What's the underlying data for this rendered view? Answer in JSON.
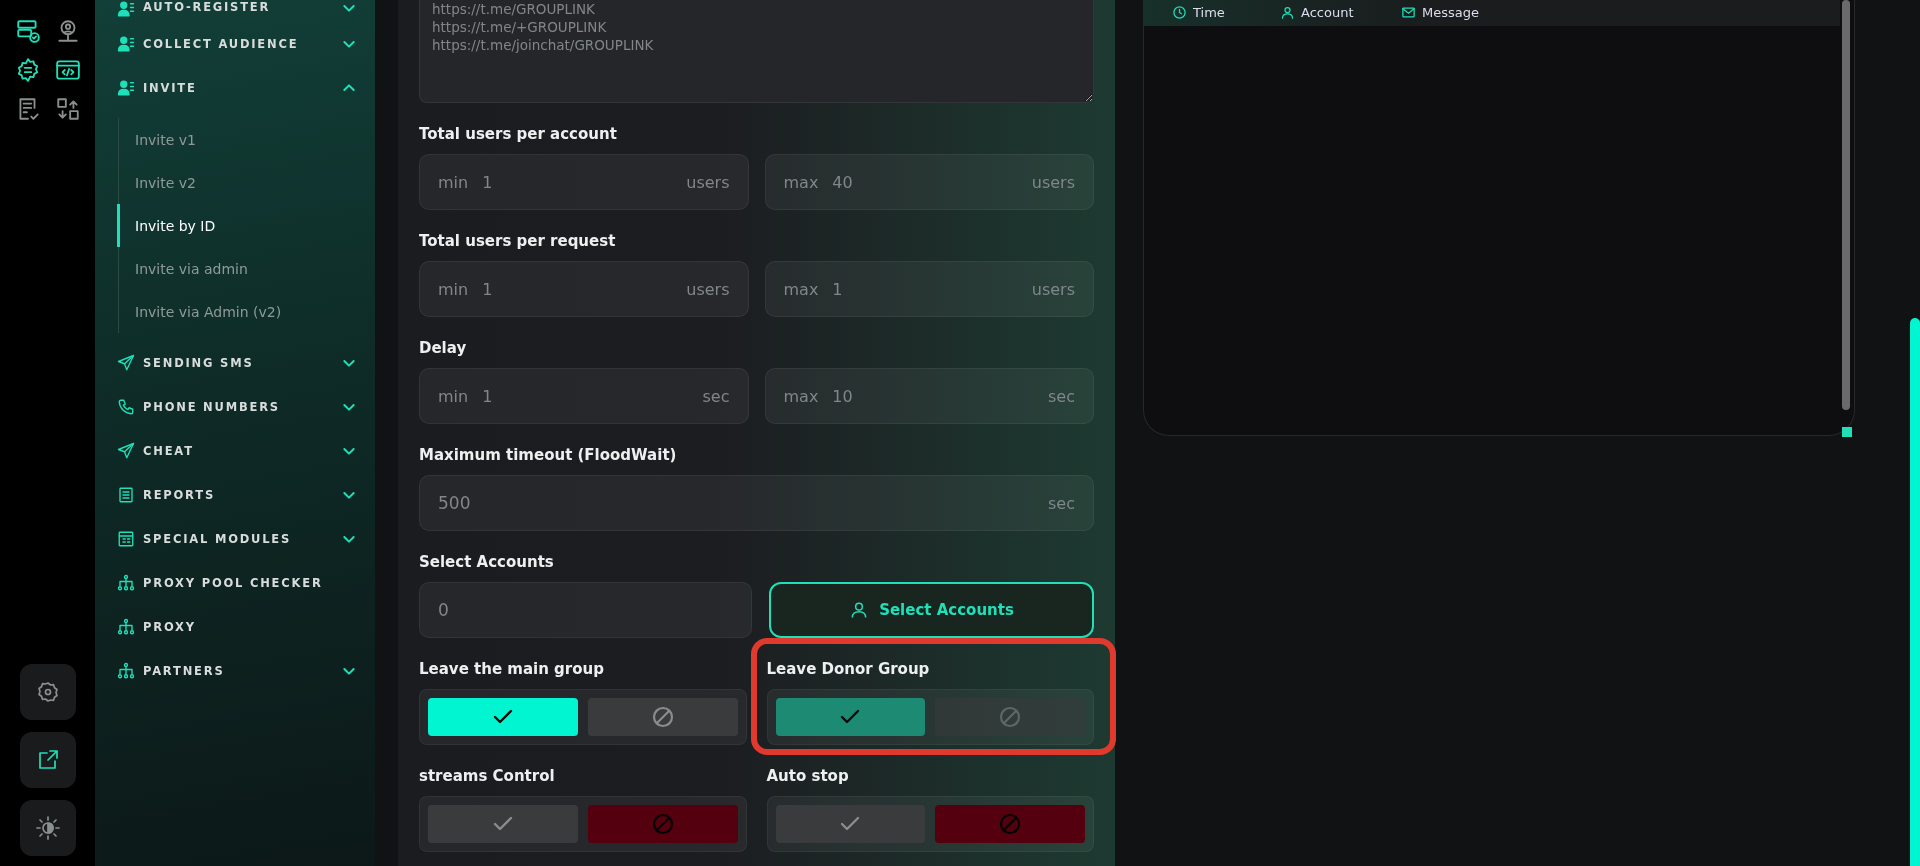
{
  "rail": {
    "icons": [
      {
        "active": true
      },
      {
        "active": false
      },
      {
        "active": true
      },
      {
        "active": true
      },
      {
        "active": false
      },
      {
        "active": false
      }
    ],
    "buttons": [
      {
        "active": false
      },
      {
        "active": true
      },
      {
        "active": false
      }
    ]
  },
  "sidebar": {
    "items": [
      {
        "label": "AUTO-REGISTER",
        "expanded": false
      },
      {
        "label": "COLLECT AUDIENCE",
        "expanded": false
      },
      {
        "label": "INVITE",
        "expanded": true,
        "children": [
          {
            "label": "Invite v1",
            "selected": false
          },
          {
            "label": "Invite v2",
            "selected": false
          },
          {
            "label": "Invite by ID",
            "selected": true
          },
          {
            "label": "Invite via admin",
            "selected": false
          },
          {
            "label": "Invite via Admin (v2)",
            "selected": false
          }
        ]
      },
      {
        "label": "SENDING SMS",
        "expanded": false
      },
      {
        "label": "PHONE NUMBERS",
        "expanded": false
      },
      {
        "label": "CHEAT",
        "expanded": false
      },
      {
        "label": "REPORTS",
        "expanded": false
      },
      {
        "label": "SPECIAL MODULES",
        "expanded": false
      },
      {
        "label": "PROXY POOL CHECKER"
      },
      {
        "label": "PROXY"
      },
      {
        "label": "PARTNERS",
        "expanded": false
      }
    ]
  },
  "form": {
    "links": {
      "placeholder": "https://t.me/GROUPLINK\nhttps://t.me/+GROUPLINK\nhttps://t.me/joinchat/GROUPLINK"
    },
    "ranges": [
      {
        "label": "Total users per account",
        "inputs": [
          {
            "prefix": "min",
            "value": "1",
            "unit": "users"
          },
          {
            "prefix": "max",
            "value": "40",
            "unit": "users"
          }
        ]
      },
      {
        "label": "Total users per request",
        "inputs": [
          {
            "prefix": "min",
            "value": "1",
            "unit": "users"
          },
          {
            "prefix": "max",
            "value": "1",
            "unit": "users"
          }
        ]
      },
      {
        "label": "Delay",
        "inputs": [
          {
            "prefix": "min",
            "value": "1",
            "unit": "sec"
          },
          {
            "prefix": "max",
            "value": "10",
            "unit": "sec"
          }
        ]
      }
    ],
    "timeout": {
      "label": "Maximum timeout (FloodWait)",
      "value": "500",
      "unit": "sec"
    },
    "accounts": {
      "label": "Select Accounts",
      "value": "0",
      "button": "Select Accounts"
    },
    "toggles": [
      {
        "label": "Leave the main group",
        "disabled": false,
        "highlighted": false,
        "options": [
          {
            "kind": "yes",
            "selected": true
          },
          {
            "kind": "no",
            "selected": false
          }
        ]
      },
      {
        "label": "Leave Donor Group",
        "disabled": true,
        "highlighted": true,
        "options": [
          {
            "kind": "yes",
            "selected": true
          },
          {
            "kind": "no",
            "selected": false
          }
        ]
      },
      {
        "label": "streams Control",
        "disabled": false,
        "highlighted": false,
        "options": [
          {
            "kind": "yes",
            "selected": false
          },
          {
            "kind": "no",
            "selected": true
          }
        ]
      },
      {
        "label": "Auto stop",
        "disabled": false,
        "highlighted": false,
        "options": [
          {
            "kind": "yes",
            "selected": false
          },
          {
            "kind": "no",
            "selected": true
          }
        ]
      }
    ]
  },
  "log": {
    "columns": [
      {
        "label": "Time"
      },
      {
        "label": "Account"
      },
      {
        "label": "Message"
      }
    ]
  }
}
